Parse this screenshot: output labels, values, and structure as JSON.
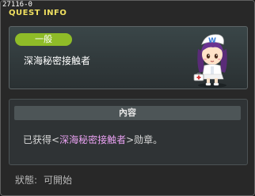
{
  "window": {
    "id": "27116-0",
    "title": "QUEST INFO"
  },
  "quest": {
    "category": "一般",
    "name": "深海秘密接触者"
  },
  "content": {
    "header": "內容",
    "text_prefix": "已获得<",
    "text_highlight": "深海秘密接触者",
    "text_suffix": ">勋章。"
  },
  "status": {
    "label": "狀態:",
    "value": "可開始"
  },
  "colors": {
    "title": "#f0e060",
    "badge": "#8fbc28",
    "highlight": "#e8a0f0"
  },
  "icons": {
    "npc": "nurse-npc-portrait-icon"
  }
}
